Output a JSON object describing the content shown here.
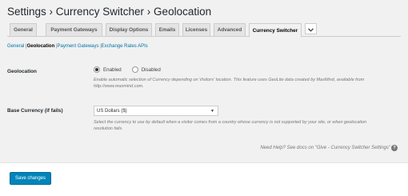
{
  "header": {
    "title": "Settings › Currency Switcher › Geolocation"
  },
  "tabs": [
    {
      "label": "General"
    },
    {
      "label": "Payment Gateways"
    },
    {
      "label": "Display Options"
    },
    {
      "label": "Emails"
    },
    {
      "label": "Licenses"
    },
    {
      "label": "Advanced"
    },
    {
      "label": "Currency Switcher",
      "active": true
    }
  ],
  "subsections": {
    "general": "General",
    "geolocation": "Geolocation",
    "payment_gateways": "Payment Gateways",
    "exchange_rates": "Exchange Rates APIs",
    "separator": "|"
  },
  "geolocation": {
    "label": "Geolocation",
    "options": [
      "Enabled",
      "Disabled"
    ],
    "selected": "Enabled",
    "description": "Enable automatic selection of Currency depending on Visitors' location. This feature uses GeoLite data created by MaxMind, available from http://www.maxmind.com."
  },
  "base_currency": {
    "label": "Base Currency (if fails)",
    "value": "US Dollars ($)",
    "description": "Select the currency to use by default when a visitor comes from a country whose currency is not supported by your site, or when geolocation resolution fails."
  },
  "help": {
    "text": "Need Help? See docs on \"Give - Currency Switcher Settings\"",
    "icon": "question-circle-icon"
  },
  "footer": {
    "save_label": "Save changes"
  },
  "colors": {
    "primary": "#0085ba",
    "link": "#0073aa",
    "background": "#f1f1f1"
  }
}
